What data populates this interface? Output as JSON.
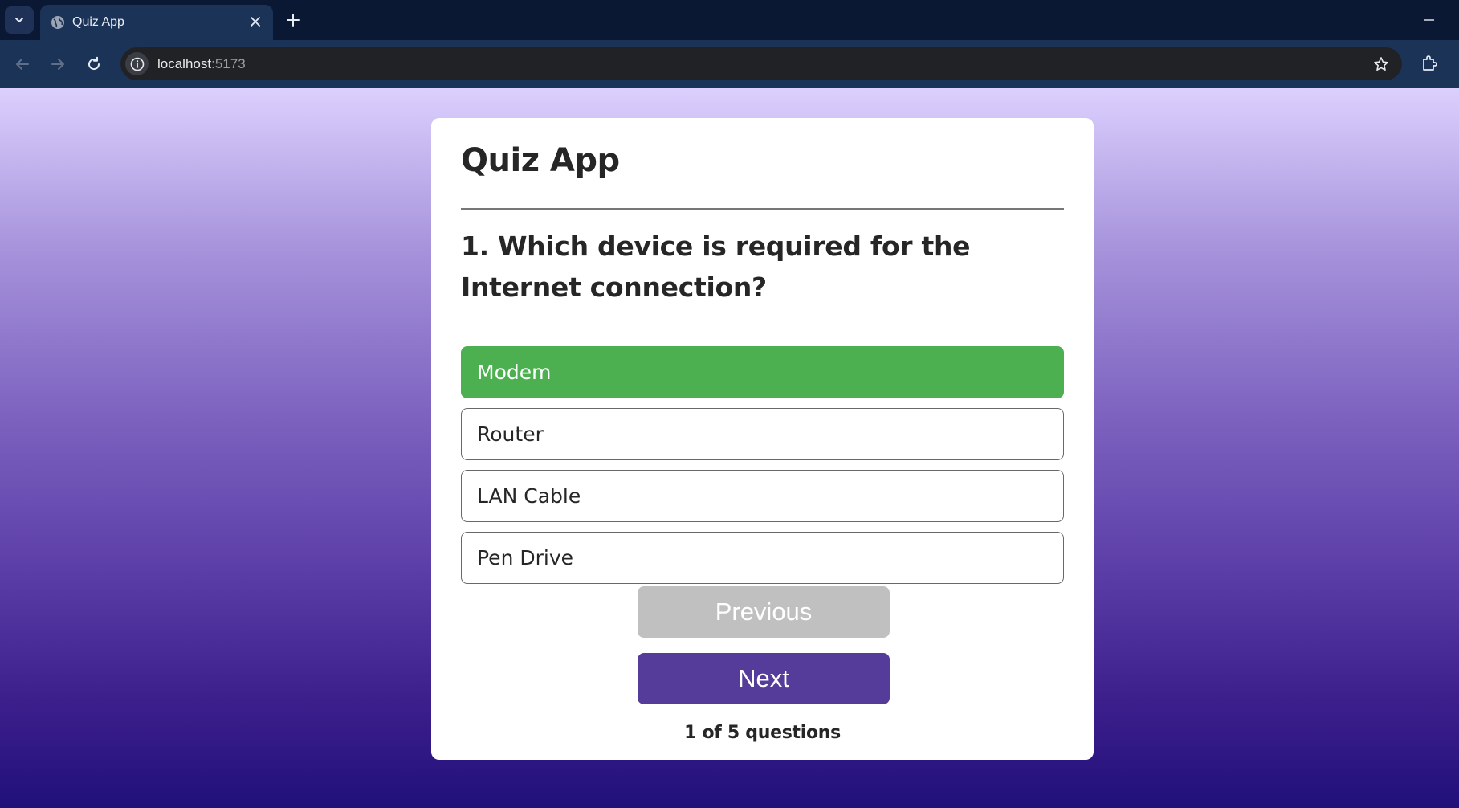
{
  "browser": {
    "tab": {
      "title": "Quiz App"
    },
    "address": {
      "host": "localhost",
      "port": ":5173"
    }
  },
  "quiz": {
    "title": "Quiz App",
    "question": "1. Which device is required for the Internet connection?",
    "options": [
      {
        "label": "Modem",
        "state": "correct"
      },
      {
        "label": "Router",
        "state": "default"
      },
      {
        "label": "LAN Cable",
        "state": "default"
      },
      {
        "label": "Pen Drive",
        "state": "default"
      }
    ],
    "buttons": {
      "previous": "Previous",
      "next": "Next"
    },
    "progress": "1 of 5 questions"
  },
  "colors": {
    "correct": "#4caf50",
    "next_button": "#553c9a",
    "previous_button": "#c0c0c0",
    "gradient_top": "#dcd0fe",
    "gradient_bottom": "#21107a"
  },
  "icons": [
    "tab-list-icon",
    "globe-icon",
    "close-icon",
    "plus-icon",
    "minimize-icon",
    "back-icon",
    "forward-icon",
    "reload-icon",
    "info-icon",
    "star-icon",
    "extensions-icon"
  ]
}
